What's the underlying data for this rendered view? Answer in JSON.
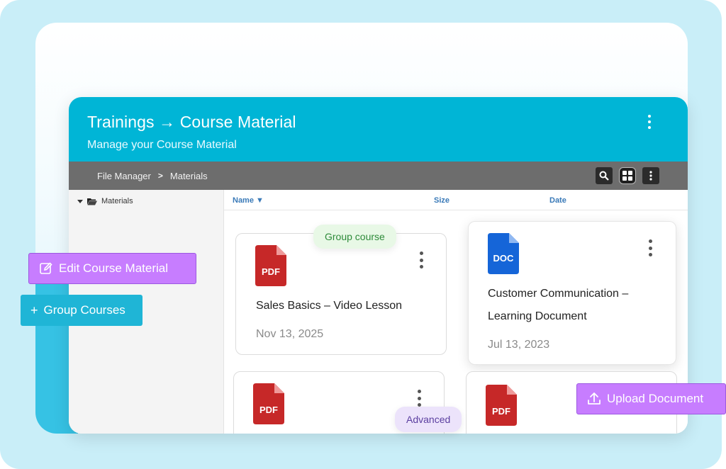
{
  "header": {
    "title": "Trainings → Course Material",
    "subtitle": "Manage your Course Material"
  },
  "breadcrumb": {
    "root": "File Manager",
    "separator": ">",
    "current": "Materials"
  },
  "sidebar": {
    "tree_root": "Materials"
  },
  "columns": {
    "name": "Name ▼",
    "size": "Size",
    "date": "Date"
  },
  "cards": [
    {
      "type": "PDF",
      "title": "Sales Basics – Video Lesson",
      "date": "Nov 13, 2025"
    },
    {
      "type": "DOC",
      "title_line1": "Customer Communication –",
      "title_line2": "Learning Document",
      "date": "Jul 13, 2023"
    },
    {
      "type": "PDF"
    },
    {
      "type": "PDF"
    }
  ],
  "tags": {
    "group_course": "Group course",
    "advanced": "Advanced"
  },
  "floating_buttons": {
    "edit": "Edit Course Material",
    "group": "Group Courses",
    "upload": "Upload Document",
    "group_plus": "+"
  },
  "colors": {
    "header": "#00b5d6",
    "toolbar": "#6d6d6d",
    "pdf_icon": "#c62828",
    "doc_icon": "#1565d8",
    "edit_button": "#c77dff",
    "group_button": "#1fb5d6",
    "upload_button": "#c77dff",
    "group_tag_text": "#2e8b3a",
    "advanced_tag_text": "#5b3fa0"
  }
}
